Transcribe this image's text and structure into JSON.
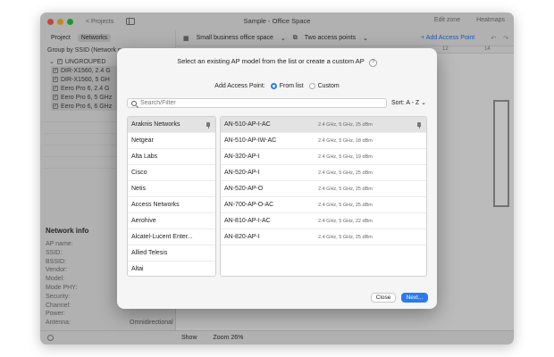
{
  "window": {
    "back_label": "< Projects",
    "title": "Sample - Office Space",
    "edit_zone": "Edit zone",
    "heatmaps": "Heatmaps"
  },
  "sidebar": {
    "tab_project": "Project",
    "tab_networks": "Networks",
    "groupby": "Group by SSID (Network na",
    "ungrouped": "UNGROUPED",
    "networks": [
      "DIR-X1560, 2.4 G",
      "DIR-X1560, 5 GH",
      "Eero Pro 6, 2.4 G",
      "Eero Pro 6, 5 GHz",
      "Eero Pro 6, 6 GHz"
    ],
    "network_info_title": "Network info",
    "info_labels": [
      "AP name:",
      "SSID:",
      "BSSID:",
      "Vendor:",
      "Model:",
      "Mode PHY:",
      "Security:",
      "Channel:",
      "Power:",
      "Antenna:"
    ],
    "antenna_value": "Omnidirectional"
  },
  "toolbar": {
    "building": "Small business office space",
    "floor": "Two access points",
    "add_ap": "+ Add Access Point"
  },
  "ruler": {
    "mark1": "12",
    "mark2": "14"
  },
  "bottom": {
    "show": "Show",
    "zoom": "Zoom 26%"
  },
  "modal": {
    "title": "Select an existing AP model from the list or create a custom AP",
    "help": "?",
    "add_label": "Add Access Point:",
    "opt_from_list": "From list",
    "opt_custom": "Custom",
    "search_placeholder": "Search/Filter",
    "sort": "Sort: A - Z",
    "vendors": [
      "Araknis Networks",
      "Netgear",
      "Alta Labs",
      "Cisco",
      "Netis",
      "Access Networks",
      "Aerohive",
      "Alcatel-Lucent Enter...",
      "Allied Telesis",
      "Altai"
    ],
    "models": [
      {
        "name": "AN-510-AP-I-AC",
        "spec": "2.4 GHz, 5 GHz, 25 dBm"
      },
      {
        "name": "AN-510-AP-IW-AC",
        "spec": "2.4 GHz, 5 GHz, 18 dBm"
      },
      {
        "name": "AN-320-AP-I",
        "spec": "2.4 GHz, 5 GHz, 19 dBm"
      },
      {
        "name": "AN-520-AP-I",
        "spec": "2.4 GHz, 5 GHz, 25 dBm"
      },
      {
        "name": "AN-520-AP-O",
        "spec": "2.4 GHz, 5 GHz, 25 dBm"
      },
      {
        "name": "AN-700-AP-O-AC",
        "spec": "2.4 GHz, 5 GHz, 25 dBm"
      },
      {
        "name": "AN-810-AP-I-AC",
        "spec": "2.4 GHz, 5 GHz, 22 dBm"
      },
      {
        "name": "AN-820-AP-I",
        "spec": "2.4 GHz, 5 GHz, 25 dBm"
      }
    ],
    "close_label": "Close",
    "next_label": "Next..."
  }
}
